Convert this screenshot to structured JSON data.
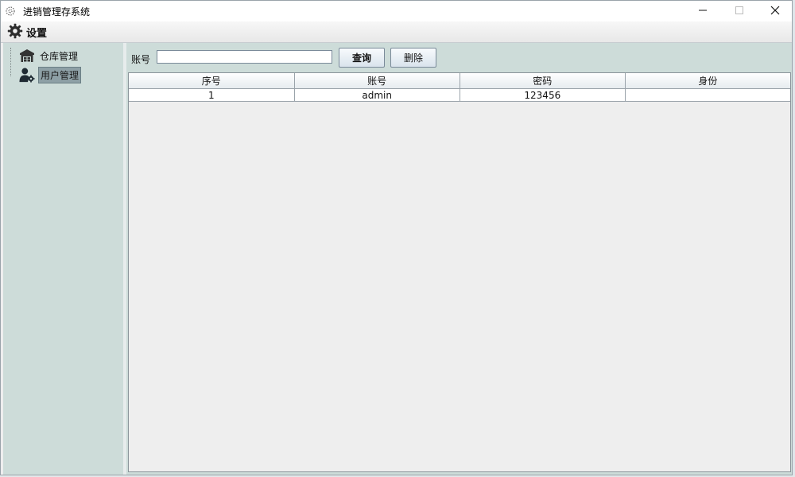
{
  "window": {
    "title": "进销管理存系统",
    "icon": "app-icon",
    "controls": {
      "minimize_icon": "minimize-icon",
      "maximize_icon": "maximize-icon",
      "close_icon": "close-icon"
    }
  },
  "menubar": {
    "settings_label": "设置",
    "settings_icon": "gear-icon"
  },
  "sidebar": {
    "items": [
      {
        "label": "仓库管理",
        "icon": "warehouse-icon",
        "selected": false
      },
      {
        "label": "用户管理",
        "icon": "user-settings-icon",
        "selected": true
      }
    ]
  },
  "toolbar": {
    "account_label": "账号",
    "account_value": "",
    "query_label": "查询",
    "delete_label": "删除"
  },
  "table": {
    "columns": [
      "序号",
      "账号",
      "密码",
      "身份"
    ],
    "rows": [
      [
        "1",
        "admin",
        "123456",
        ""
      ]
    ]
  },
  "colors": {
    "panel_bg": "#cddcd9",
    "table_bg": "#eeeeee",
    "selection": "#8ea0a6"
  }
}
